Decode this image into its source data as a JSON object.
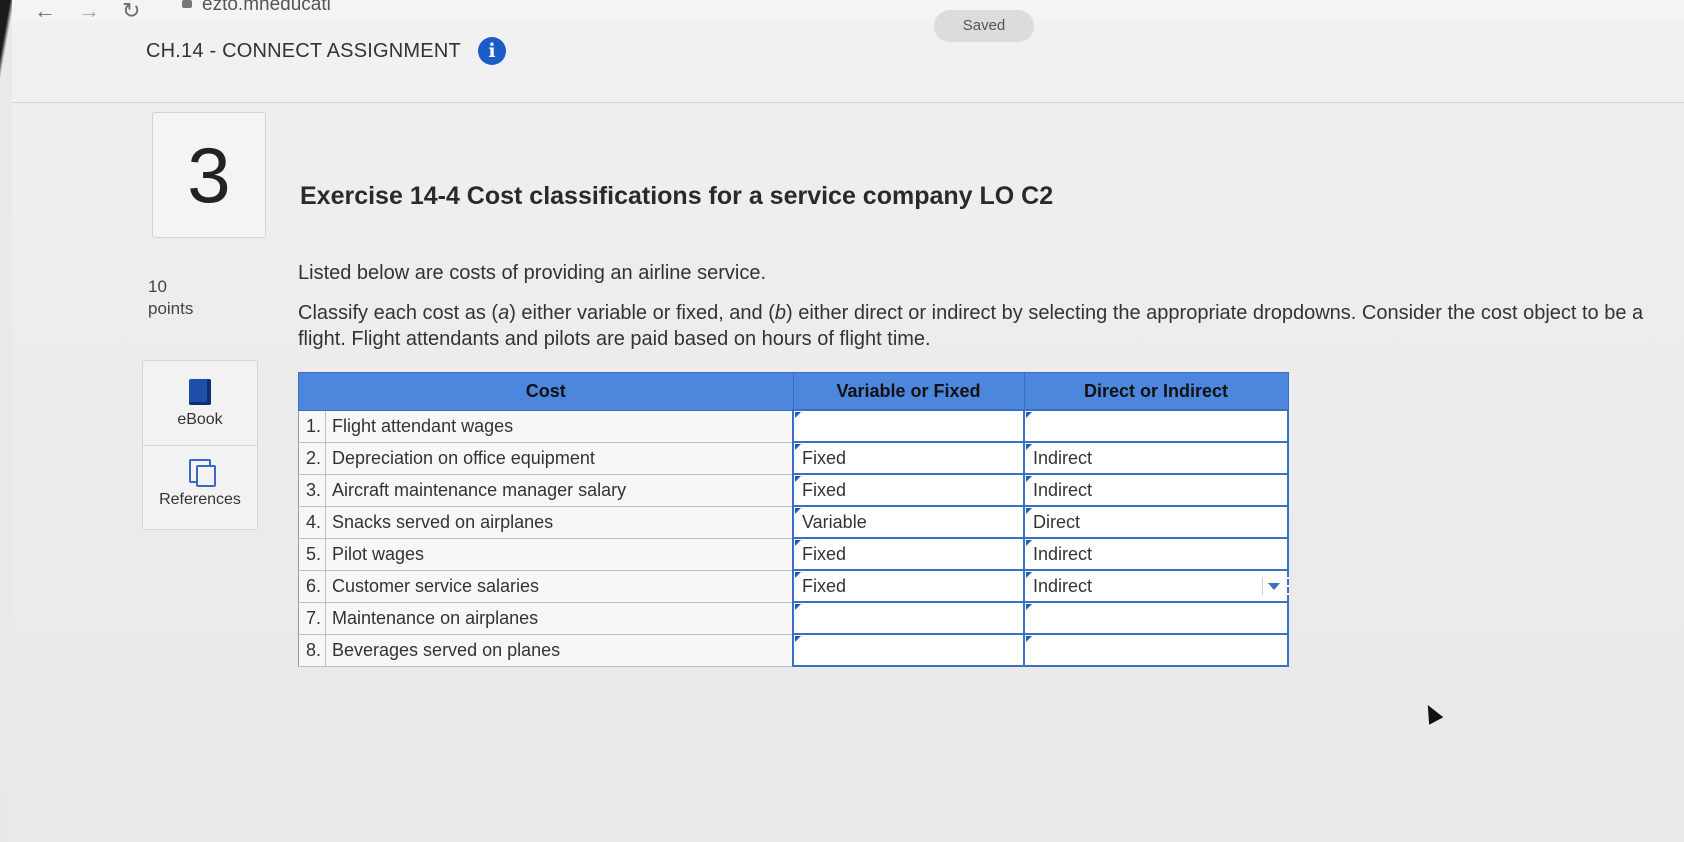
{
  "browser": {
    "url": "ezto.mheducati",
    "back_icon": "arrow-left-icon",
    "forward_icon": "arrow-right-icon",
    "reload_icon": "reload-icon"
  },
  "header": {
    "saved_label": "Saved",
    "assignment_title": "CH.14 - CONNECT ASSIGNMENT",
    "info_glyph": "i"
  },
  "question": {
    "number": "3",
    "points_value": "10",
    "points_label": "points"
  },
  "sidebar": {
    "ebook_label": "eBook",
    "references_label": "References"
  },
  "exercise": {
    "title": "Exercise 14-4 Cost classifications for a service company LO C2",
    "intro": "Listed below are costs of providing an airline service.",
    "instr_part1": "Classify each cost as (",
    "instr_a": "a",
    "instr_part2": ") either variable or fixed, and (",
    "instr_b": "b",
    "instr_part3": ") either direct or indirect by selecting the appropriate dropdowns. Consider the cost object to be a flight. Flight attendants and pilots are paid based on hours of flight time."
  },
  "table": {
    "headers": {
      "cost": "Cost",
      "variable_fixed": "Variable or Fixed",
      "direct_indirect": "Direct or Indirect"
    },
    "rows": [
      {
        "num": "1.",
        "cost": "Flight attendant wages",
        "vf": "",
        "di": ""
      },
      {
        "num": "2.",
        "cost": "Depreciation on office equipment",
        "vf": "Fixed",
        "di": "Indirect"
      },
      {
        "num": "3.",
        "cost": "Aircraft maintenance manager salary",
        "vf": "Fixed",
        "di": "Indirect"
      },
      {
        "num": "4.",
        "cost": "Snacks served on airplanes",
        "vf": "Variable",
        "di": "Direct"
      },
      {
        "num": "5.",
        "cost": "Pilot wages",
        "vf": "Fixed",
        "di": "Indirect"
      },
      {
        "num": "6.",
        "cost": "Customer service salaries",
        "vf": "Fixed",
        "di": "Indirect"
      },
      {
        "num": "7.",
        "cost": "Maintenance on airplanes",
        "vf": "",
        "di": ""
      },
      {
        "num": "8.",
        "cost": "Beverages served on planes",
        "vf": "",
        "di": ""
      }
    ]
  },
  "colors": {
    "accent": "#4d86dd",
    "info": "#1a5cc8"
  }
}
